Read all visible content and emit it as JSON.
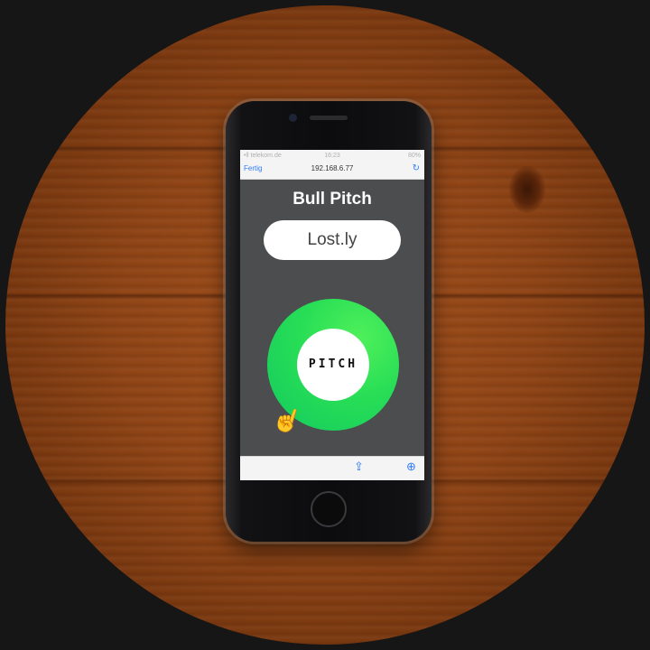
{
  "status_bar": {
    "carrier": "•ll telekom.de",
    "time": "16:23",
    "battery": "80%"
  },
  "browser": {
    "done_label": "Fertig",
    "url": "192.168.6.77"
  },
  "app": {
    "title": "Bull Pitch",
    "name_value": "Lost.ly",
    "pitch_label": "PITCH"
  },
  "colors": {
    "ring_green": "#28de56",
    "ios_blue": "#2f7cf6",
    "screen_bg": "#4b4d4f",
    "cursor_yellow": "#f2c21b"
  },
  "icons": {
    "reload": "reload-icon",
    "share": "share-icon",
    "compass": "compass-icon",
    "cursor": "pointer-hand-icon"
  }
}
